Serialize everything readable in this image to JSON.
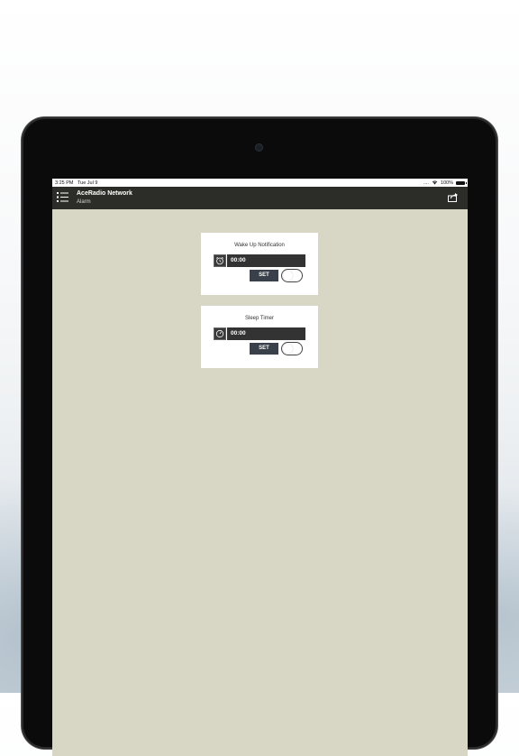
{
  "status_bar": {
    "time": "3:25 PM",
    "date": "Tue Jul 9",
    "signal": "....",
    "battery": "100%"
  },
  "navbar": {
    "title": "AceRadio Network",
    "subtitle": "Alarm"
  },
  "wake_up": {
    "title": "Wake Up Notification",
    "time_value": "00:00",
    "set_label": "SET",
    "toggle_on": false
  },
  "sleep_timer": {
    "title": "Sleep Timer",
    "time_value": "00:00",
    "set_label": "SET",
    "toggle_on": false
  },
  "icons": {
    "menu": "menu-list-icon",
    "share": "share-icon",
    "wake_up": "alarm-clock-icon",
    "sleep_timer": "timer-icon",
    "wifi": "wifi-icon",
    "battery": "battery-icon"
  },
  "colors": {
    "navbar": "#2c2c28",
    "background": "#d8d6c4",
    "card": "#ffffff",
    "set_button": "#3a4049",
    "time_field": "#333333"
  }
}
